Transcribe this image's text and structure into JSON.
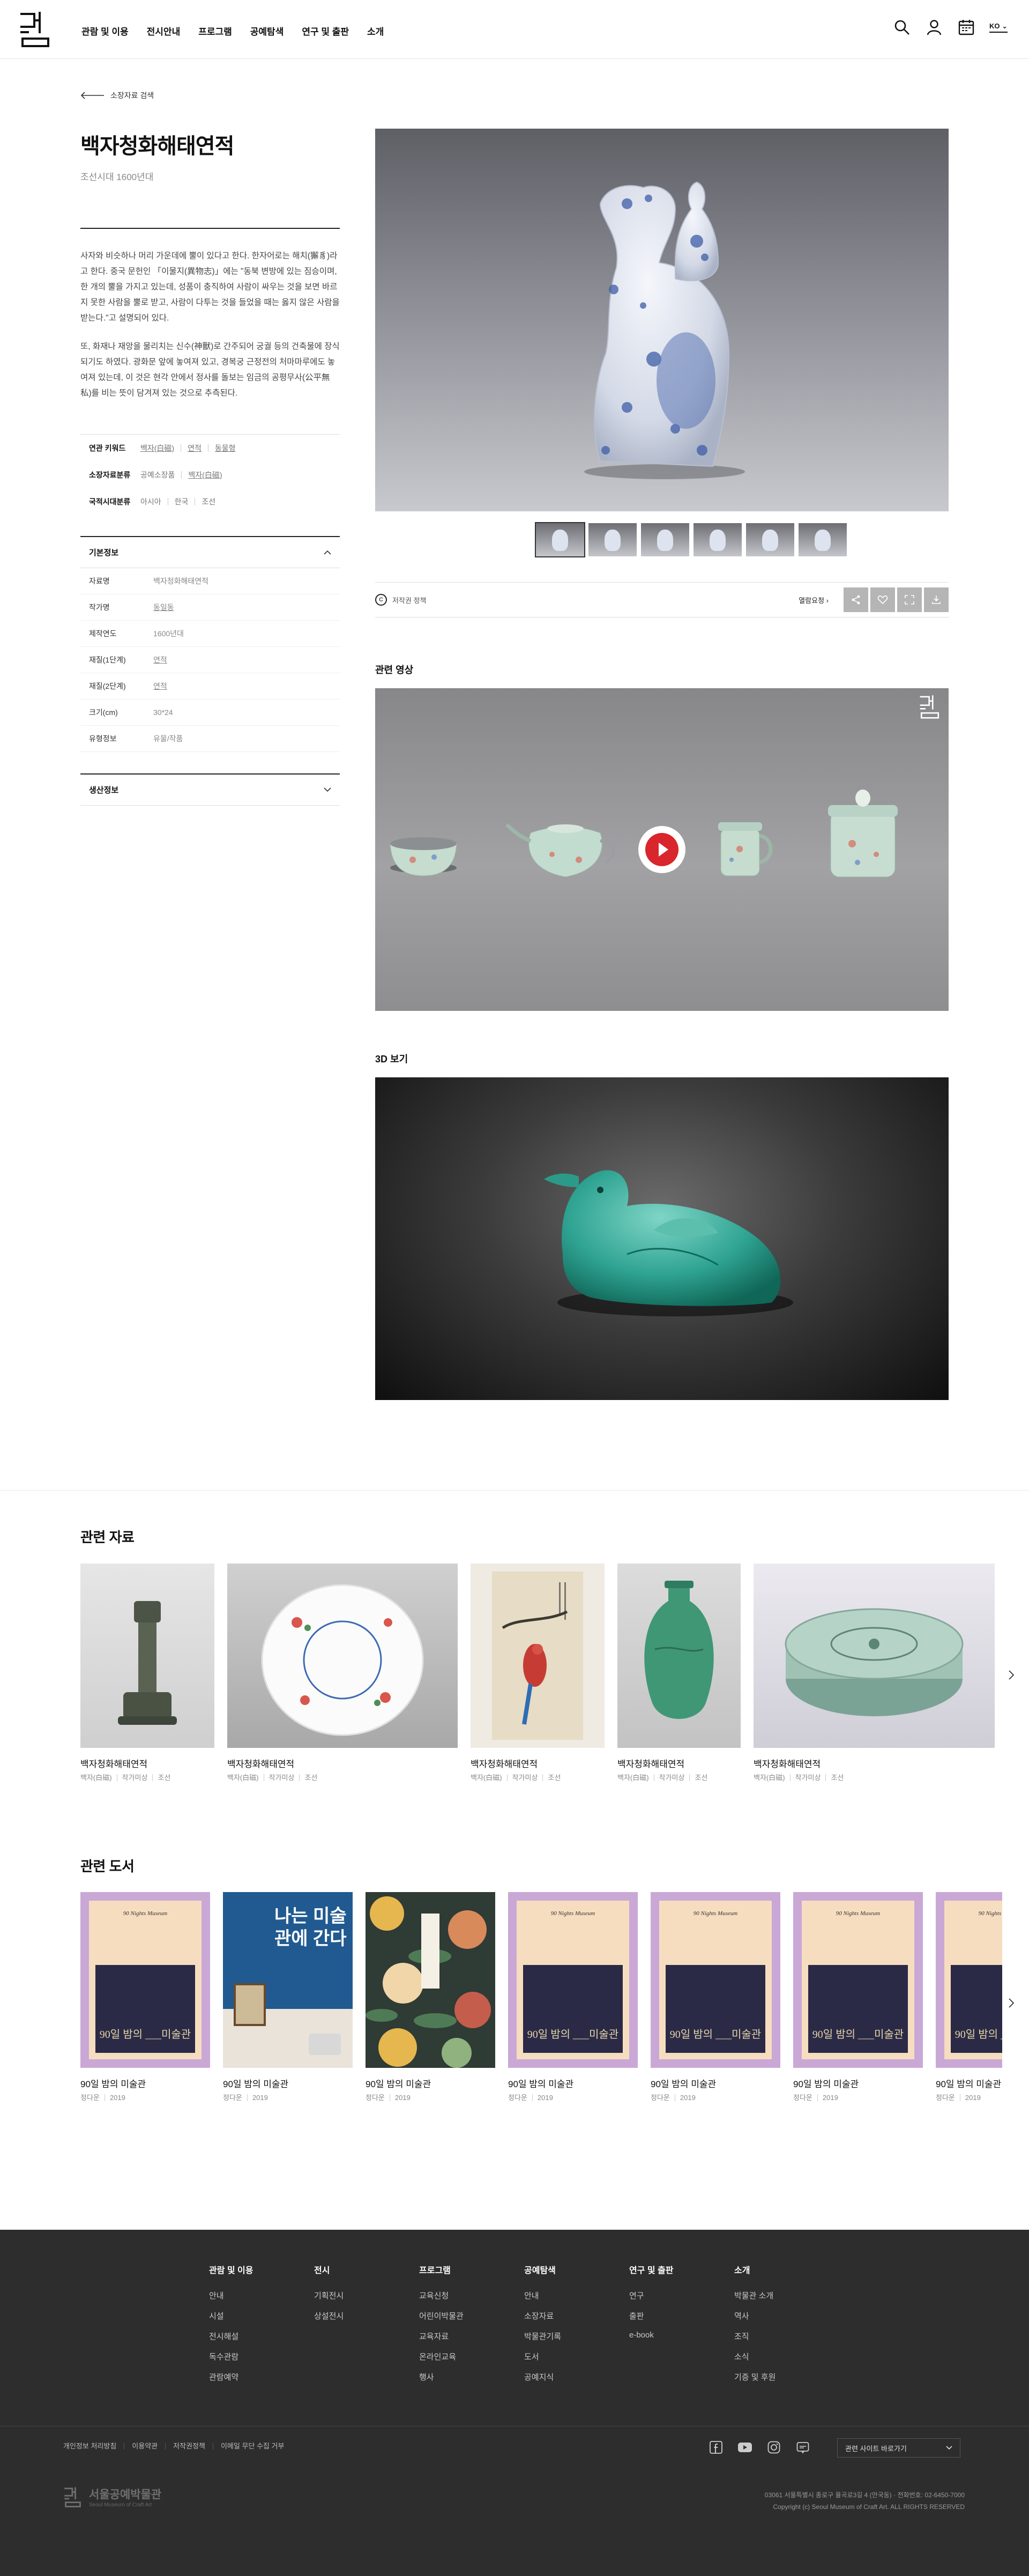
{
  "header": {
    "nav": [
      "관람 및 이용",
      "전시안내",
      "프로그램",
      "공예탐색",
      "연구 및 출판",
      "소개"
    ],
    "lang": "KO"
  },
  "back_link": "소장자료 검색",
  "object": {
    "title": "백자청화해태연적",
    "subtitle": "조선시대 1600년대",
    "description": [
      "사자와 비슷하나 머리 가운데에 뿔이 있다고 한다. 한자어로는 해치(獬豸)라고 한다. 중국 문헌인 「이물지(異物志)」에는 \"동북 변방에 있는 짐승이며, 한 개의 뿔을 가지고 있는데, 성품이 충직하여 사람이 싸우는 것을 보면 바르지 못한 사람을 뿔로 받고, 사람이 다투는 것을 들었을 때는 옳지 않은 사람을 받는다.\"고 설명되어 있다.",
      "또, 화재나 재앙을 물리치는 신수(神獸)로 간주되어 궁궐 등의 건축물에 장식되기도 하였다. 광화문 앞에 놓여져 있고, 경복궁 근정전의 처마마루에도 놓여져 있는데, 이 것은 현각 안에서 정사를 돌보는 임금의 공평무사(公平無私)를 비는 뜻이 담겨져 있는 것으로 추측된다."
    ],
    "keywords": [
      {
        "label": "연관 키워드",
        "values": [
          "백자(白磁)",
          "연적",
          "동물형"
        ]
      },
      {
        "label": "소장자료분류",
        "values": [
          "공예소장품",
          "백자(白磁)"
        ]
      },
      {
        "label": "국적시대분류",
        "values": [
          "아시아",
          "한국",
          "조선"
        ]
      }
    ],
    "basic_info_title": "기본정보",
    "basic_info": [
      {
        "label": "자료명",
        "value": "백자청화해태연적"
      },
      {
        "label": "작가명",
        "value": "동일동"
      },
      {
        "label": "제작연도",
        "value": "1600년대"
      },
      {
        "label": "재질(1단계)",
        "value": "연적"
      },
      {
        "label": "재질(2단계)",
        "value": "연적"
      },
      {
        "label": "크기(cm)",
        "value": "30*24"
      },
      {
        "label": "유형정보",
        "value": "유물/작품"
      }
    ],
    "production_title": "생산정보"
  },
  "rights": {
    "license": "저작권 정책",
    "request": "열람요청"
  },
  "sections": {
    "video": "관련 영상",
    "viewer3d": "3D 보기",
    "related_items": "관련 자료",
    "related_books": "관련 도서"
  },
  "related_items": [
    {
      "title": "백자청화해태연적",
      "meta": [
        "백자(白磁)",
        "작가미상",
        "조선"
      ]
    },
    {
      "title": "백자청화해태연적",
      "meta": [
        "백자(白磁)",
        "작가미상",
        "조선"
      ]
    },
    {
      "title": "백자청화해태연적",
      "meta": [
        "백자(白磁)",
        "작가미상",
        "조선"
      ]
    },
    {
      "title": "백자청화해태연적",
      "meta": [
        "백자(白磁)",
        "작가미상",
        "조선"
      ]
    },
    {
      "title": "백자청화해태연적",
      "meta": [
        "백자(白磁)",
        "작가미상",
        "조선"
      ]
    }
  ],
  "related_books": [
    {
      "title": "90일 밤의 미술관",
      "author": "정다운",
      "year": "2019",
      "cover_text": "90일 밤의 ___미술관"
    },
    {
      "title": "90일 밤의 미술관",
      "author": "정다운",
      "year": "2019",
      "cover_text": "나는 미술관에 간다"
    },
    {
      "title": "90일 밤의 미술관",
      "author": "정다운",
      "year": "2019",
      "cover_text": ""
    },
    {
      "title": "90일 밤의 미술관",
      "author": "정다운",
      "year": "2019",
      "cover_text": "90일 밤의 ___미술관"
    },
    {
      "title": "90일 밤의 미술관",
      "author": "정다운",
      "year": "2019",
      "cover_text": "90일 밤의 ___미술관"
    },
    {
      "title": "90일 밤의 미술관",
      "author": "정다운",
      "year": "2019",
      "cover_text": "90일 밤의 ___미술관"
    },
    {
      "title": "90일 밤의 미술관",
      "author": "정다운",
      "year": "2019",
      "cover_text": "90일 밤의 ___미술관"
    }
  ],
  "footer": {
    "columns": [
      {
        "title": "관람 및 이용",
        "items": [
          "안내",
          "시설",
          "전시해설",
          "독수관람",
          "관람예약"
        ]
      },
      {
        "title": "전시",
        "items": [
          "기획전시",
          "상설전시"
        ]
      },
      {
        "title": "프로그램",
        "items": [
          "교육신청",
          "어린이박물관",
          "교육자료",
          "온라인교육",
          "행사"
        ]
      },
      {
        "title": "공예탐색",
        "items": [
          "안내",
          "소장자료",
          "박물관기록",
          "도서",
          "공예지식"
        ]
      },
      {
        "title": "연구 및 출판",
        "items": [
          "연구",
          "출판",
          "e-book"
        ]
      },
      {
        "title": "소개",
        "items": [
          "박물관 소개",
          "역사",
          "조직",
          "소식",
          "기증 및 후원"
        ]
      }
    ],
    "links": [
      "개인정보 처리방침",
      "이용약관",
      "저작권정책",
      "이메일 무단 수집 거부"
    ],
    "related_sites": "관련 사이트 바로가기",
    "logo_kr": "서울공예박물관",
    "logo_en": "Seoul Museum of Craft Art",
    "address": "03061 서울특별시 종로구 율곡로3길 4 (안국동) · 전화번호: 02-6450-7000",
    "copyright": "Copyright (c) Seoul Museum of Craft Art. ALL RIGHTS RESERVED"
  }
}
